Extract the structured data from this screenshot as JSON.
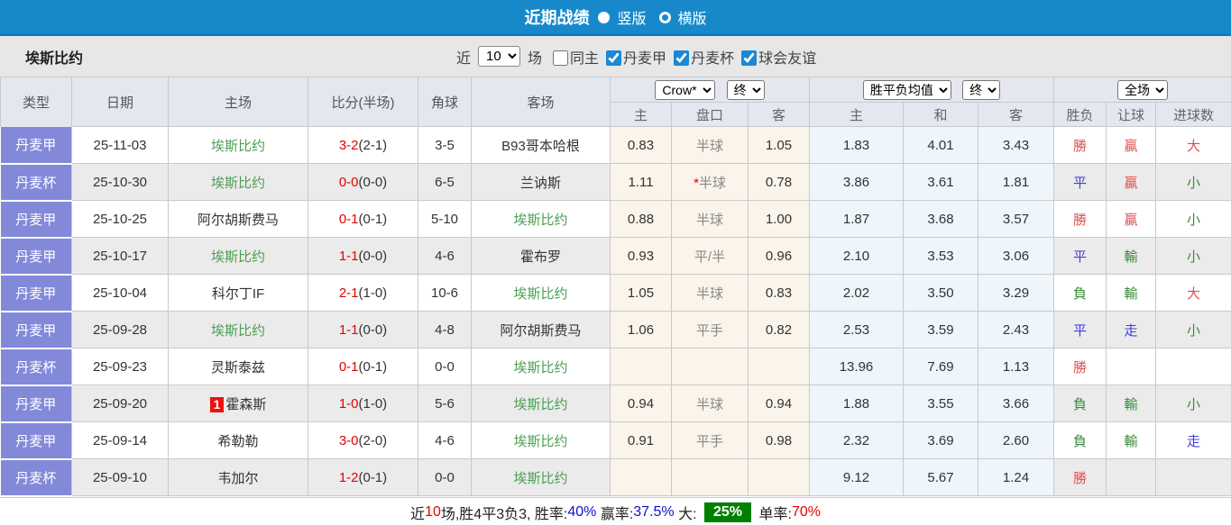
{
  "colors": {
    "topbar_blue": "#1789cb",
    "type_column": "#8289d9",
    "self_team_green": "#4a9e52",
    "score_red": "#e60000",
    "result_red": "#e05050",
    "result_blue": "#4040d8",
    "result_green": "#3a8a3a",
    "summary_badge_green": "#008000",
    "checkbox_blue": "#1b87d6"
  },
  "titlebar": {
    "title": "近期战绩",
    "radios": [
      {
        "label": "竖版",
        "selected": true
      },
      {
        "label": "横版",
        "selected": false
      }
    ]
  },
  "filterbar": {
    "team": "埃斯比约",
    "near_label": "近",
    "matches_value": "10",
    "matches_label": "场",
    "checkboxes": [
      {
        "label": "同主",
        "checked": false
      },
      {
        "label": "丹麦甲",
        "checked": true
      },
      {
        "label": "丹麦杯",
        "checked": true
      },
      {
        "label": "球会友谊",
        "checked": true
      }
    ]
  },
  "table": {
    "main_headers": [
      "类型",
      "日期",
      "主场",
      "比分(半场)",
      "角球",
      "客场"
    ],
    "dropdowns": {
      "bookmaker": "Crow*",
      "handicap_time": "终",
      "avg_label": "胜平负均值",
      "avg_time": "终",
      "scope": "全场"
    },
    "sub_headers": [
      "主",
      "盘口",
      "客",
      "主",
      "和",
      "客",
      "胜负",
      "让球",
      "进球数"
    ],
    "rows": [
      {
        "type": "丹麦甲",
        "date": "25-11-03",
        "badge": "",
        "home": "埃斯比约",
        "home_self": true,
        "score": "3-2",
        "half": "(2-1)",
        "corner": "3-5",
        "away": "B93哥本哈根",
        "away_self": false,
        "ah_home": "0.83",
        "ah_star": false,
        "ah_line": "半球",
        "ah_away": "1.05",
        "avg_w": "1.83",
        "avg_d": "4.01",
        "avg_l": "3.43",
        "res": [
          {
            "t": "勝",
            "c": "red"
          },
          {
            "t": "贏",
            "c": "red"
          },
          {
            "t": "大",
            "c": "red"
          }
        ]
      },
      {
        "type": "丹麦杯",
        "date": "25-10-30",
        "badge": "",
        "home": "埃斯比约",
        "home_self": true,
        "score": "0-0",
        "half": "(0-0)",
        "corner": "6-5",
        "away": "兰讷斯",
        "away_self": false,
        "ah_home": "1.11",
        "ah_star": true,
        "ah_line": "半球",
        "ah_away": "0.78",
        "avg_w": "3.86",
        "avg_d": "3.61",
        "avg_l": "1.81",
        "res": [
          {
            "t": "平",
            "c": "blue"
          },
          {
            "t": "贏",
            "c": "red"
          },
          {
            "t": "小",
            "c": "green"
          }
        ]
      },
      {
        "type": "丹麦甲",
        "date": "25-10-25",
        "badge": "",
        "home": "阿尔胡斯费马",
        "home_self": false,
        "score": "0-1",
        "half": "(0-1)",
        "corner": "5-10",
        "away": "埃斯比约",
        "away_self": true,
        "ah_home": "0.88",
        "ah_star": false,
        "ah_line": "半球",
        "ah_away": "1.00",
        "avg_w": "1.87",
        "avg_d": "3.68",
        "avg_l": "3.57",
        "res": [
          {
            "t": "勝",
            "c": "red"
          },
          {
            "t": "贏",
            "c": "red"
          },
          {
            "t": "小",
            "c": "green"
          }
        ]
      },
      {
        "type": "丹麦甲",
        "date": "25-10-17",
        "badge": "",
        "home": "埃斯比约",
        "home_self": true,
        "score": "1-1",
        "half": "(0-0)",
        "corner": "4-6",
        "away": "霍布罗",
        "away_self": false,
        "ah_home": "0.93",
        "ah_star": false,
        "ah_line": "平/半",
        "ah_away": "0.96",
        "avg_w": "2.10",
        "avg_d": "3.53",
        "avg_l": "3.06",
        "res": [
          {
            "t": "平",
            "c": "blue"
          },
          {
            "t": "輸",
            "c": "green"
          },
          {
            "t": "小",
            "c": "green"
          }
        ]
      },
      {
        "type": "丹麦甲",
        "date": "25-10-04",
        "badge": "",
        "home": "科尔丁IF",
        "home_self": false,
        "score": "2-1",
        "half": "(1-0)",
        "corner": "10-6",
        "away": "埃斯比约",
        "away_self": true,
        "ah_home": "1.05",
        "ah_star": false,
        "ah_line": "半球",
        "ah_away": "0.83",
        "avg_w": "2.02",
        "avg_d": "3.50",
        "avg_l": "3.29",
        "res": [
          {
            "t": "負",
            "c": "green"
          },
          {
            "t": "輸",
            "c": "green"
          },
          {
            "t": "大",
            "c": "red"
          }
        ]
      },
      {
        "type": "丹麦甲",
        "date": "25-09-28",
        "badge": "",
        "home": "埃斯比约",
        "home_self": true,
        "score": "1-1",
        "half": "(0-0)",
        "corner": "4-8",
        "away": "阿尔胡斯费马",
        "away_self": false,
        "ah_home": "1.06",
        "ah_star": false,
        "ah_line": "平手",
        "ah_away": "0.82",
        "avg_w": "2.53",
        "avg_d": "3.59",
        "avg_l": "2.43",
        "res": [
          {
            "t": "平",
            "c": "blue"
          },
          {
            "t": "走",
            "c": "blue"
          },
          {
            "t": "小",
            "c": "green"
          }
        ]
      },
      {
        "type": "丹麦杯",
        "date": "25-09-23",
        "badge": "",
        "home": "灵斯泰兹",
        "home_self": false,
        "score": "0-1",
        "half": "(0-1)",
        "corner": "0-0",
        "away": "埃斯比约",
        "away_self": true,
        "ah_home": "",
        "ah_star": false,
        "ah_line": "",
        "ah_away": "",
        "avg_w": "13.96",
        "avg_d": "7.69",
        "avg_l": "1.13",
        "res": [
          {
            "t": "勝",
            "c": "red"
          },
          {
            "t": "",
            "c": ""
          },
          {
            "t": "",
            "c": ""
          }
        ]
      },
      {
        "type": "丹麦甲",
        "date": "25-09-20",
        "badge": "1",
        "home": "霍森斯",
        "home_self": false,
        "score": "1-0",
        "half": "(1-0)",
        "corner": "5-6",
        "away": "埃斯比约",
        "away_self": true,
        "ah_home": "0.94",
        "ah_star": false,
        "ah_line": "半球",
        "ah_away": "0.94",
        "avg_w": "1.88",
        "avg_d": "3.55",
        "avg_l": "3.66",
        "res": [
          {
            "t": "負",
            "c": "green"
          },
          {
            "t": "輸",
            "c": "green"
          },
          {
            "t": "小",
            "c": "green"
          }
        ]
      },
      {
        "type": "丹麦甲",
        "date": "25-09-14",
        "badge": "",
        "home": "希勒勒",
        "home_self": false,
        "score": "3-0",
        "half": "(2-0)",
        "corner": "4-6",
        "away": "埃斯比约",
        "away_self": true,
        "ah_home": "0.91",
        "ah_star": false,
        "ah_line": "平手",
        "ah_away": "0.98",
        "avg_w": "2.32",
        "avg_d": "3.69",
        "avg_l": "2.60",
        "res": [
          {
            "t": "負",
            "c": "green"
          },
          {
            "t": "輸",
            "c": "green"
          },
          {
            "t": "走",
            "c": "blue"
          }
        ]
      },
      {
        "type": "丹麦杯",
        "date": "25-09-10",
        "badge": "",
        "home": "韦加尔",
        "home_self": false,
        "score": "1-2",
        "half": "(0-1)",
        "corner": "0-0",
        "away": "埃斯比约",
        "away_self": true,
        "ah_home": "",
        "ah_star": false,
        "ah_line": "",
        "ah_away": "",
        "avg_w": "9.12",
        "avg_d": "5.67",
        "avg_l": "1.24",
        "res": [
          {
            "t": "勝",
            "c": "red"
          },
          {
            "t": "",
            "c": ""
          },
          {
            "t": "",
            "c": ""
          }
        ]
      }
    ]
  },
  "summary": {
    "segments": [
      {
        "t": "近",
        "c": "black"
      },
      {
        "t": "10",
        "c": "red"
      },
      {
        "t": "场,胜4平3负3, ",
        "c": "black"
      },
      {
        "t": "胜率:",
        "c": "black"
      },
      {
        "t": "40%",
        "c": "blue"
      },
      {
        "t": " 赢率:",
        "c": "black"
      },
      {
        "t": "37.5%",
        "c": "blue"
      },
      {
        "t": " 大: ",
        "c": "black"
      },
      {
        "t": "25%",
        "c": "greenbadge"
      },
      {
        "t": " 单率:",
        "c": "black"
      },
      {
        "t": "70%",
        "c": "red"
      }
    ]
  }
}
